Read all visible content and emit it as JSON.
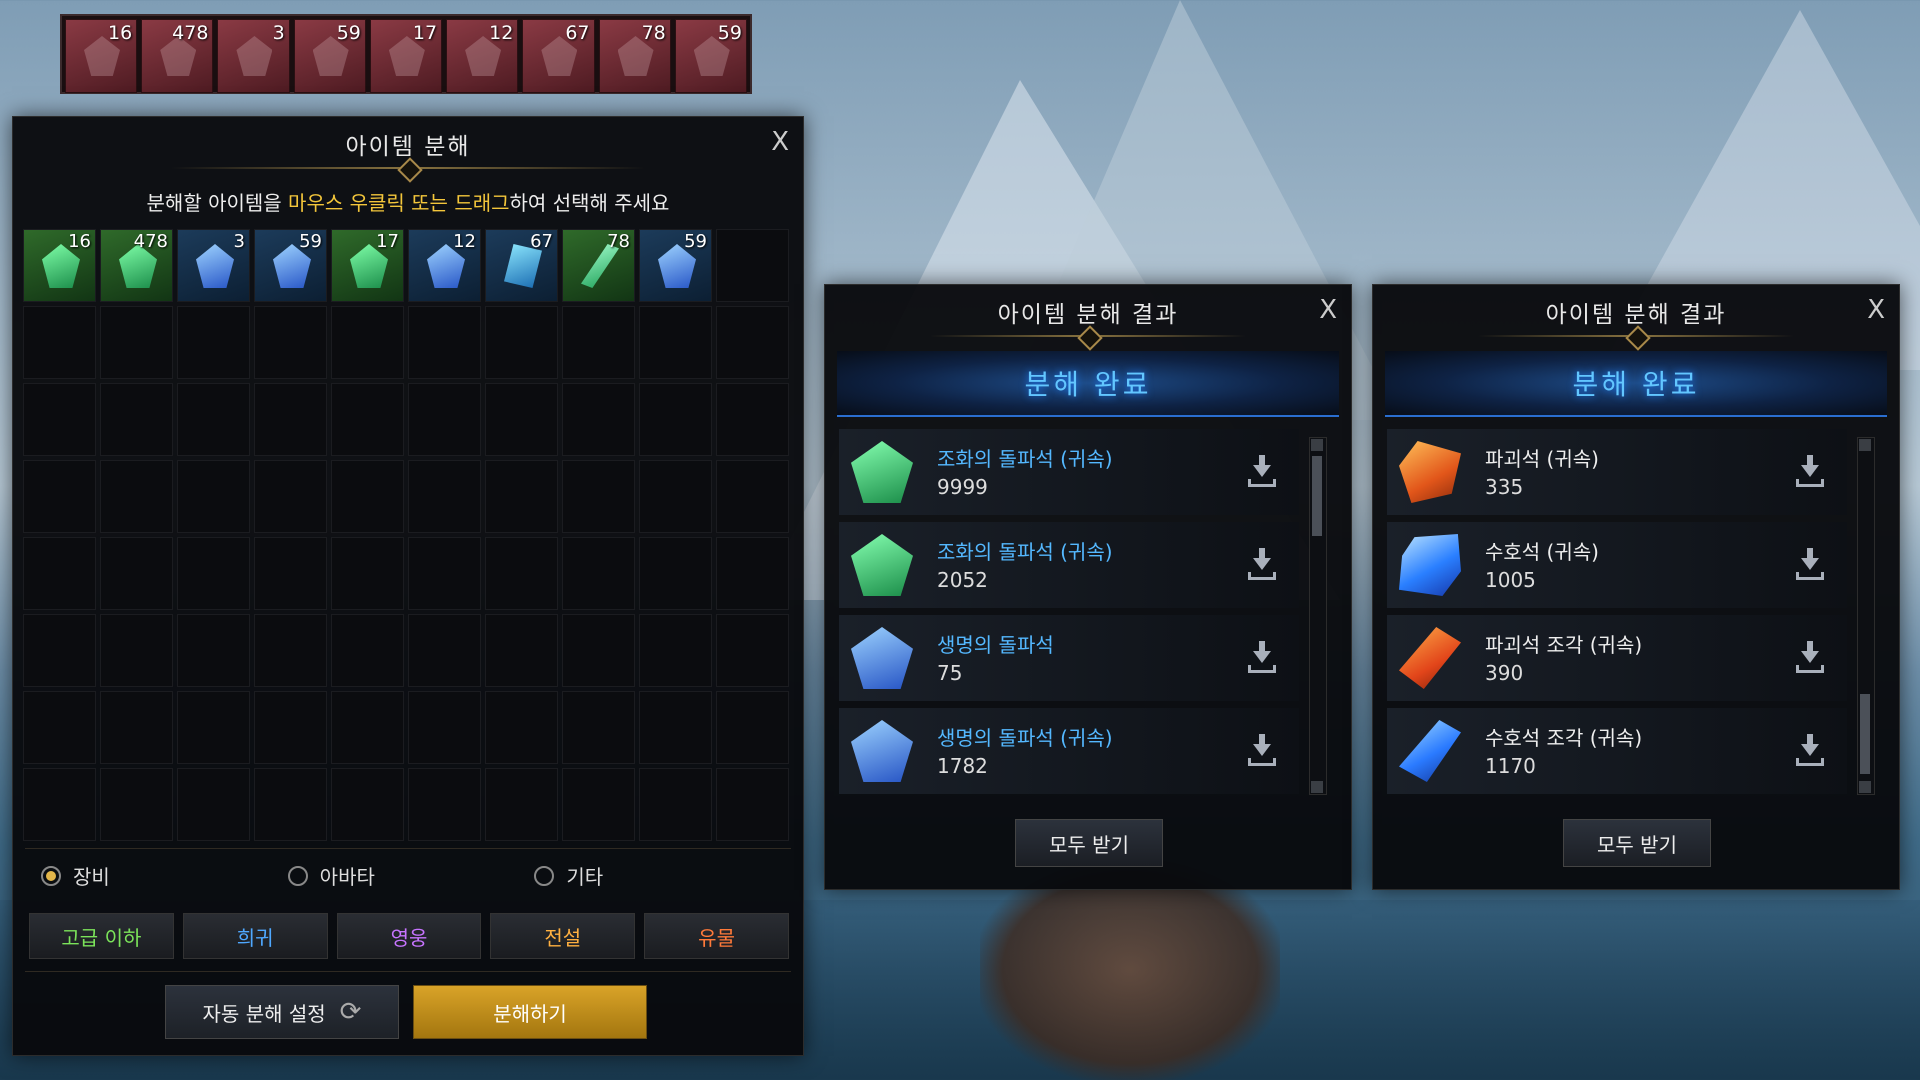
{
  "hotbar": {
    "slots": [
      {
        "count": "16"
      },
      {
        "count": "478"
      },
      {
        "count": "3"
      },
      {
        "count": "59"
      },
      {
        "count": "17"
      },
      {
        "count": "12"
      },
      {
        "count": "67"
      },
      {
        "count": "78"
      },
      {
        "count": "59"
      }
    ]
  },
  "disassemble": {
    "title": "아이템 분해",
    "close": "X",
    "instruction_prefix": "분해할 아이템을 ",
    "instruction_highlight": "마우스 우클릭 또는 드래그",
    "instruction_suffix": "하여 선택해 주세요",
    "items": [
      {
        "count": "16",
        "icon": "green-gem-icon"
      },
      {
        "count": "478",
        "icon": "green-gem-icon"
      },
      {
        "count": "3",
        "icon": "blue-gem-icon"
      },
      {
        "count": "59",
        "icon": "blue-gem-icon"
      },
      {
        "count": "17",
        "icon": "green-gem-icon"
      },
      {
        "count": "12",
        "icon": "blue-gem-icon"
      },
      {
        "count": "67",
        "icon": "blue-crystal-icon"
      },
      {
        "count": "78",
        "icon": "green-crystal-icon"
      },
      {
        "count": "59",
        "icon": "blue-gem-icon"
      }
    ],
    "categories": {
      "equipment": "장비",
      "avatar": "아바타",
      "etc": "기타",
      "selected": "equipment"
    },
    "grades": {
      "advanced": "고급 이하",
      "rare": "희귀",
      "hero": "영웅",
      "legend": "전설",
      "relic": "유물"
    },
    "auto_button": "자동 분해 설정",
    "main_button": "분해하기"
  },
  "results": [
    {
      "title": "아이템 분해 결과",
      "close": "X",
      "banner": "분해 완료",
      "items": [
        {
          "name": "조화의 돌파석 (귀속)",
          "count": "9999",
          "icon": "green-gem-icon"
        },
        {
          "name": "조화의 돌파석 (귀속)",
          "count": "2052",
          "icon": "green-gem-icon"
        },
        {
          "name": "생명의 돌파석",
          "count": "75",
          "icon": "blue-gem-icon"
        },
        {
          "name": "생명의 돌파석 (귀속)",
          "count": "1782",
          "icon": "blue-gem-icon"
        }
      ],
      "receive_all": "모두 받기"
    },
    {
      "title": "아이템 분해 결과",
      "close": "X",
      "banner": "분해 완료",
      "items": [
        {
          "name": "파괴석 (귀속)",
          "count": "335",
          "icon": "orange-stone-icon"
        },
        {
          "name": "수호석 (귀속)",
          "count": "1005",
          "icon": "blue-stone-icon"
        },
        {
          "name": "파괴석 조각 (귀속)",
          "count": "390",
          "icon": "orange-shard-icon"
        },
        {
          "name": "수호석 조각 (귀속)",
          "count": "1170",
          "icon": "blue-shard-icon"
        }
      ],
      "receive_all": "모두 받기"
    }
  ],
  "colors": {
    "highlight": "#f3c63b",
    "item_name_blue": "#54b8ff",
    "banner_text": "#62c6ff",
    "main_button": "#d9a328",
    "grade_advanced": "#7be35a",
    "grade_rare": "#4fa8ff",
    "grade_hero": "#c774ff",
    "grade_legend": "#ffb040",
    "grade_relic": "#ff7a3a"
  }
}
